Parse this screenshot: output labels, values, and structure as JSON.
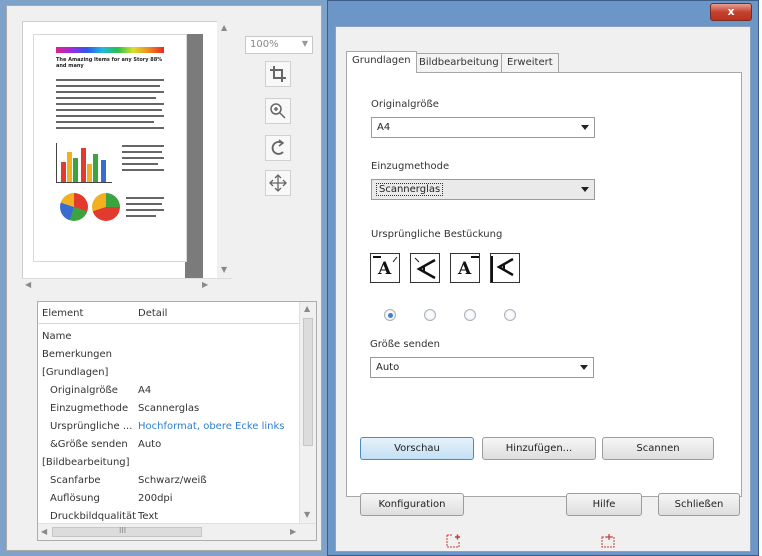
{
  "preview": {
    "doc_headline": "The Amazing Items for any Story 88% and many"
  },
  "zoom": {
    "value": "100%"
  },
  "tools": {
    "crop": "crop-icon",
    "zoom": "zoom-in-icon",
    "rotate": "rotate-icon",
    "move": "move-icon"
  },
  "details": {
    "header_element": "Element",
    "header_detail": "Detail",
    "rows": [
      {
        "element": "Name",
        "detail": "",
        "indent": false
      },
      {
        "element": "Bemerkungen",
        "detail": "",
        "indent": false
      },
      {
        "element": "[Grundlagen]",
        "detail": "",
        "indent": false
      },
      {
        "element": "Originalgröße",
        "detail": "A4",
        "indent": true
      },
      {
        "element": "Einzugmethode",
        "detail": "Scannerglas",
        "indent": true
      },
      {
        "element": "Ursprüngliche ...",
        "detail": "Hochformat, obere Ecke links",
        "indent": true,
        "highlight": true
      },
      {
        "element": "&Größe senden",
        "detail": "Auto",
        "indent": true
      },
      {
        "element": "[Bildbearbeitung]",
        "detail": "",
        "indent": false
      },
      {
        "element": "Scanfarbe",
        "detail": "Schwarz/weiß",
        "indent": true
      },
      {
        "element": "Auflösung",
        "detail": "200dpi",
        "indent": true
      },
      {
        "element": "Druckbildqualität",
        "detail": "Text",
        "indent": true
      }
    ],
    "hscroll_grip": "III"
  },
  "dialog": {
    "close_label": "x",
    "tabs": [
      {
        "label": "Grundlagen",
        "active": true
      },
      {
        "label": "Bildbearbeitung",
        "active": false
      },
      {
        "label": "Erweitert",
        "active": false
      }
    ],
    "originalgroesse": {
      "label": "Originalgröße",
      "value": "A4"
    },
    "einzugmethode": {
      "label": "Einzugmethode",
      "value": "Scannerglas"
    },
    "bestueckung": {
      "label": "Ursprüngliche Bestückung",
      "glyph": "A",
      "selected_index": 0
    },
    "groesse_senden": {
      "label": "Größe senden",
      "value": "Auto"
    },
    "buttons": {
      "vorschau": "Vorschau",
      "hinzufuegen": "Hinzufügen...",
      "scannen": "Scannen",
      "konfiguration": "Konfiguration",
      "hilfe": "Hilfe",
      "schliessen": "Schließen"
    }
  },
  "colors": {
    "accent_blue": "#3f80c8",
    "window_frame": "#6b96c7",
    "link_text": "#2f7fd0",
    "close_red": "#c4422f"
  }
}
